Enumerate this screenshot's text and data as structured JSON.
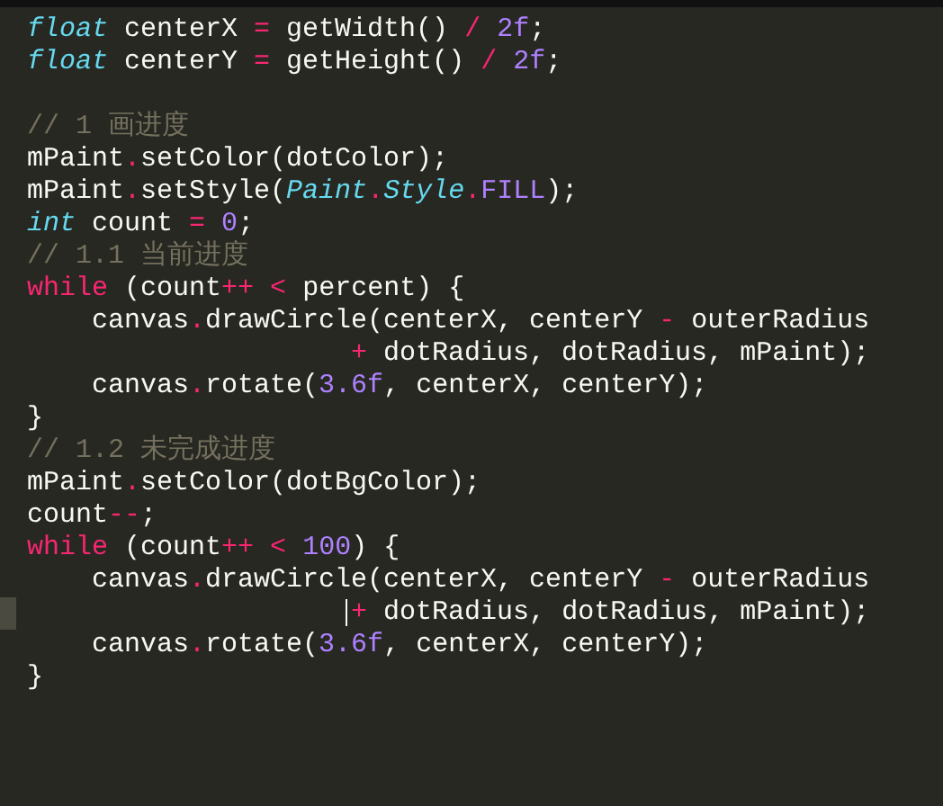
{
  "editor": {
    "lines": [
      {
        "current": false,
        "tokens": [
          {
            "kind": "type",
            "text": "float"
          },
          {
            "kind": "plain",
            "text": " centerX "
          },
          {
            "kind": "op",
            "text": "="
          },
          {
            "kind": "plain",
            "text": " getWidth() "
          },
          {
            "kind": "op",
            "text": "/"
          },
          {
            "kind": "num",
            "text": " 2f"
          },
          {
            "kind": "plain",
            "text": ";"
          }
        ]
      },
      {
        "current": false,
        "tokens": [
          {
            "kind": "type",
            "text": "float"
          },
          {
            "kind": "plain",
            "text": " centerY "
          },
          {
            "kind": "op",
            "text": "="
          },
          {
            "kind": "plain",
            "text": " getHeight() "
          },
          {
            "kind": "op",
            "text": "/"
          },
          {
            "kind": "num",
            "text": " 2f"
          },
          {
            "kind": "plain",
            "text": ";"
          }
        ]
      },
      {
        "current": false
      },
      {
        "current": false,
        "tokens": [
          {
            "kind": "comment",
            "text": "// 1 画进度"
          }
        ]
      },
      {
        "current": false,
        "tokens": [
          {
            "kind": "plain",
            "text": "mPaint"
          },
          {
            "kind": "op",
            "text": "."
          },
          {
            "kind": "plain",
            "text": "setColor(dotColor);"
          }
        ]
      },
      {
        "current": false,
        "tokens": [
          {
            "kind": "plain",
            "text": "mPaint"
          },
          {
            "kind": "op",
            "text": "."
          },
          {
            "kind": "plain",
            "text": "setStyle("
          },
          {
            "kind": "type",
            "text": "Paint"
          },
          {
            "kind": "op",
            "text": "."
          },
          {
            "kind": "type",
            "text": "Style"
          },
          {
            "kind": "op",
            "text": "."
          },
          {
            "kind": "num",
            "text": "FILL"
          },
          {
            "kind": "plain",
            "text": ");"
          }
        ]
      },
      {
        "current": false,
        "tokens": [
          {
            "kind": "type",
            "text": "int"
          },
          {
            "kind": "plain",
            "text": " count "
          },
          {
            "kind": "op",
            "text": "="
          },
          {
            "kind": "num",
            "text": " 0"
          },
          {
            "kind": "plain",
            "text": ";"
          }
        ]
      },
      {
        "current": false,
        "tokens": [
          {
            "kind": "comment",
            "text": "// 1.1 当前进度"
          }
        ]
      },
      {
        "current": false,
        "tokens": [
          {
            "kind": "op",
            "text": "while"
          },
          {
            "kind": "plain",
            "text": " (count"
          },
          {
            "kind": "op",
            "text": "++"
          },
          {
            "kind": "op",
            "text": " <"
          },
          {
            "kind": "plain",
            "text": " percent) {"
          }
        ]
      },
      {
        "current": false,
        "tokens": [
          {
            "kind": "plain",
            "text": "    canvas"
          },
          {
            "kind": "op",
            "text": "."
          },
          {
            "kind": "plain",
            "text": "drawCircle(centerX, centerY "
          },
          {
            "kind": "op",
            "text": "-"
          },
          {
            "kind": "plain",
            "text": " outerRadius"
          }
        ]
      },
      {
        "current": false,
        "tokens": [
          {
            "kind": "op",
            "text": "                    +"
          },
          {
            "kind": "plain",
            "text": " dotRadius, dotRadius, mPaint);"
          }
        ]
      },
      {
        "current": false,
        "tokens": [
          {
            "kind": "plain",
            "text": "    canvas"
          },
          {
            "kind": "op",
            "text": "."
          },
          {
            "kind": "plain",
            "text": "rotate("
          },
          {
            "kind": "num",
            "text": "3.6f"
          },
          {
            "kind": "plain",
            "text": ", centerX, centerY);"
          }
        ]
      },
      {
        "current": false,
        "tokens": [
          {
            "kind": "plain",
            "text": "}"
          }
        ]
      },
      {
        "current": false,
        "tokens": [
          {
            "kind": "comment",
            "text": "// 1.2 未完成进度"
          }
        ]
      },
      {
        "current": false,
        "tokens": [
          {
            "kind": "plain",
            "text": "mPaint"
          },
          {
            "kind": "op",
            "text": "."
          },
          {
            "kind": "plain",
            "text": "setColor(dotBgColor);"
          }
        ]
      },
      {
        "current": false,
        "tokens": [
          {
            "kind": "plain",
            "text": "count"
          },
          {
            "kind": "op",
            "text": "--"
          },
          {
            "kind": "plain",
            "text": ";"
          }
        ]
      },
      {
        "current": false,
        "tokens": [
          {
            "kind": "op",
            "text": "while"
          },
          {
            "kind": "plain",
            "text": " (count"
          },
          {
            "kind": "op",
            "text": "++"
          },
          {
            "kind": "op",
            "text": " <"
          },
          {
            "kind": "num",
            "text": " 100"
          },
          {
            "kind": "plain",
            "text": ") {"
          }
        ]
      },
      {
        "current": false,
        "tokens": [
          {
            "kind": "plain",
            "text": "    canvas"
          },
          {
            "kind": "op",
            "text": "."
          },
          {
            "kind": "plain",
            "text": "drawCircle(centerX, centerY "
          },
          {
            "kind": "op",
            "text": "-"
          },
          {
            "kind": "plain",
            "text": " outerRadius"
          }
        ]
      },
      {
        "current": true,
        "tokens": [
          {
            "kind": "op",
            "text": "                    +"
          },
          {
            "kind": "plain",
            "text": " dotRadius, dotRadius, mPaint);"
          }
        ]
      },
      {
        "current": false,
        "tokens": [
          {
            "kind": "plain",
            "text": "    canvas"
          },
          {
            "kind": "op",
            "text": "."
          },
          {
            "kind": "plain",
            "text": "rotate("
          },
          {
            "kind": "num",
            "text": "3.6f"
          },
          {
            "kind": "plain",
            "text": ", centerX, centerY);"
          }
        ]
      },
      {
        "current": false,
        "tokens": [
          {
            "kind": "plain",
            "text": "}"
          }
        ]
      }
    ]
  }
}
